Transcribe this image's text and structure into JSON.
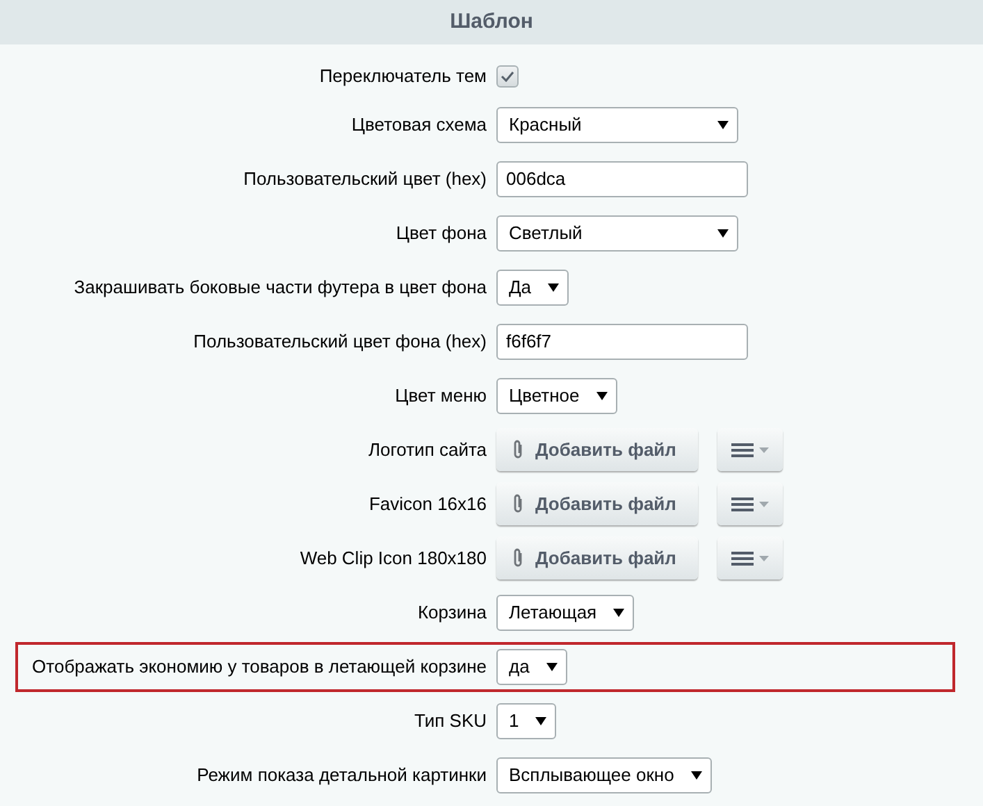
{
  "header": {
    "title": "Шаблон"
  },
  "rows": [
    {
      "kind": "checkbox",
      "label": "Переключатель тем",
      "checked": true,
      "highlighted": false
    },
    {
      "kind": "dropdown",
      "label": "Цветовая схема",
      "value": "Красный",
      "highlighted": false
    },
    {
      "kind": "text",
      "label": "Пользовательский цвет (hex)",
      "value": "006dca",
      "highlighted": false
    },
    {
      "kind": "dropdown",
      "label": "Цвет фона",
      "value": "Светлый",
      "highlighted": false
    },
    {
      "kind": "select",
      "label": "Закрашивать боковые части футера в цвет фона",
      "value": "Да",
      "highlighted": false
    },
    {
      "kind": "text",
      "label": "Пользовательский цвет фона (hex)",
      "value": "f6f6f7",
      "highlighted": false
    },
    {
      "kind": "select",
      "label": "Цвет меню",
      "value": "Цветное",
      "highlighted": false
    },
    {
      "kind": "file",
      "label": "Логотип сайта",
      "button": "Добавить файл",
      "highlighted": false
    },
    {
      "kind": "file",
      "label": "Favicon 16x16",
      "button": "Добавить файл",
      "highlighted": false
    },
    {
      "kind": "file",
      "label": "Web Clip Icon 180x180",
      "button": "Добавить файл",
      "highlighted": false
    },
    {
      "kind": "select",
      "label": "Корзина",
      "value": "Летающая",
      "highlighted": false
    },
    {
      "kind": "select",
      "label": "Отображать экономию у товаров в летающей корзине",
      "value": "да",
      "highlighted": true
    },
    {
      "kind": "select",
      "label": "Тип SKU",
      "value": "1",
      "highlighted": false
    },
    {
      "kind": "select",
      "label": "Режим показа детальной картинки",
      "value": "Всплывающее окно",
      "highlighted": false
    }
  ]
}
